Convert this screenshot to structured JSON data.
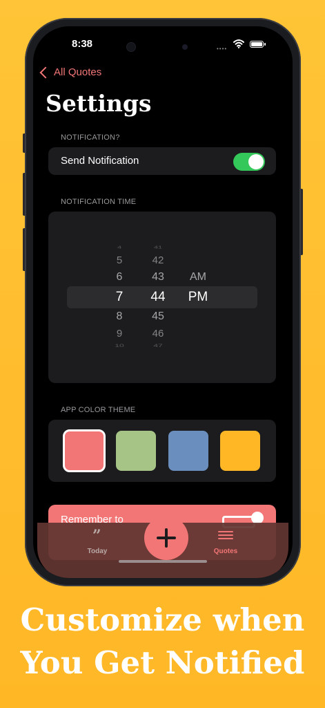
{
  "status": {
    "time": "8:38",
    "signal": "••••"
  },
  "nav": {
    "back_label": "All Quotes",
    "title": "Settings"
  },
  "notification": {
    "section": "NOTIFICATION?",
    "label": "Send Notification",
    "enabled": true
  },
  "time_picker": {
    "section": "NOTIFICATION TIME",
    "hours": [
      "4",
      "5",
      "6",
      "7",
      "8",
      "9",
      "10"
    ],
    "minutes": [
      "41",
      "42",
      "43",
      "44",
      "45",
      "46",
      "47"
    ],
    "periods": [
      "AM",
      "PM"
    ],
    "selected": {
      "hour": "7",
      "minute": "44",
      "period": "PM"
    }
  },
  "theme": {
    "section": "APP COLOR THEME",
    "swatches": [
      "#F27676",
      "#A7C487",
      "#6A8FBF",
      "#FFB726"
    ],
    "selected": 0
  },
  "banner": {
    "text": "Remember to"
  },
  "tabs": {
    "today": "Today",
    "quotes": "Quotes",
    "active": "quotes"
  },
  "caption": {
    "line1": "Customize when",
    "line2": "You Get Notified"
  },
  "colors": {
    "accent": "#F27676",
    "toggle_on": "#34C759",
    "background": "#FFBC2E"
  }
}
